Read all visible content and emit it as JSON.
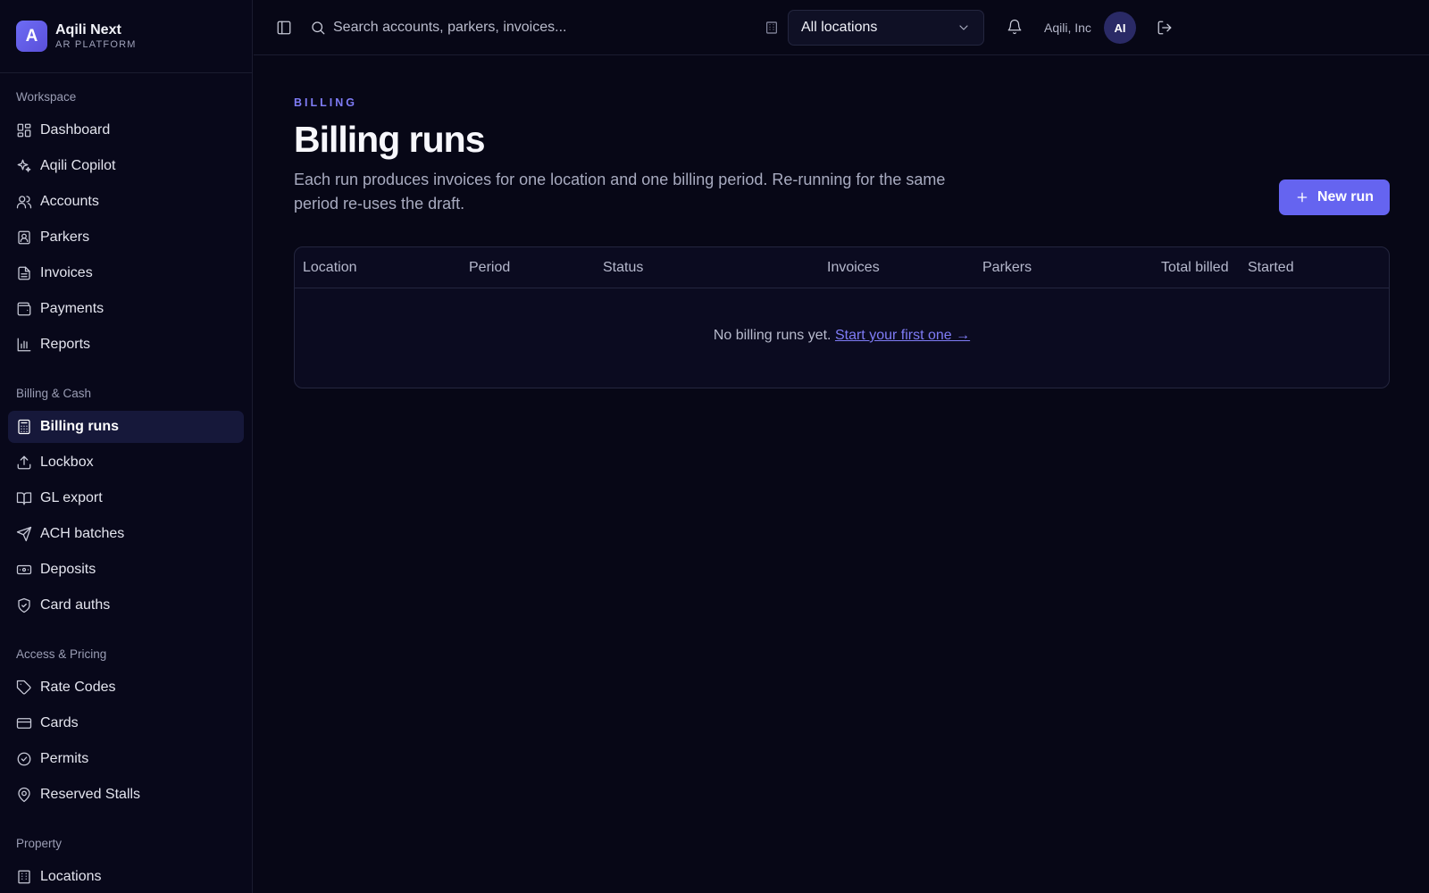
{
  "brand": {
    "logo_letter": "A",
    "name": "Aqili Next",
    "subtitle": "AR PLATFORM"
  },
  "sidebar": {
    "sections": [
      {
        "heading": "Workspace",
        "items": [
          {
            "label": "Dashboard",
            "icon": "dashboard-icon"
          },
          {
            "label": "Aqili Copilot",
            "icon": "sparkles-icon"
          },
          {
            "label": "Accounts",
            "icon": "users-icon"
          },
          {
            "label": "Parkers",
            "icon": "contact-icon"
          },
          {
            "label": "Invoices",
            "icon": "file-text-icon"
          },
          {
            "label": "Payments",
            "icon": "wallet-icon"
          },
          {
            "label": "Reports",
            "icon": "bar-chart-icon"
          }
        ]
      },
      {
        "heading": "Billing & Cash",
        "items": [
          {
            "label": "Billing runs",
            "icon": "calculator-icon",
            "active": true
          },
          {
            "label": "Lockbox",
            "icon": "upload-icon"
          },
          {
            "label": "GL export",
            "icon": "book-icon"
          },
          {
            "label": "ACH batches",
            "icon": "send-icon"
          },
          {
            "label": "Deposits",
            "icon": "banknote-icon"
          },
          {
            "label": "Card auths",
            "icon": "shield-check-icon"
          }
        ]
      },
      {
        "heading": "Access & Pricing",
        "items": [
          {
            "label": "Rate Codes",
            "icon": "tag-icon"
          },
          {
            "label": "Cards",
            "icon": "credit-card-icon"
          },
          {
            "label": "Permits",
            "icon": "badge-check-icon"
          },
          {
            "label": "Reserved Stalls",
            "icon": "map-pin-icon"
          }
        ]
      },
      {
        "heading": "Property",
        "items": [
          {
            "label": "Locations",
            "icon": "building-icon"
          }
        ]
      }
    ]
  },
  "topbar": {
    "search_placeholder": "Search accounts, parkers, invoices...",
    "location_selected": "All locations",
    "org_name": "Aqili, Inc",
    "avatar_initials": "AI"
  },
  "page": {
    "eyebrow": "BILLING",
    "title": "Billing runs",
    "description": "Each run produces invoices for one location and one billing period. Re-running for the same period re-uses the draft.",
    "new_run_label": "New run"
  },
  "table": {
    "columns": [
      "Location",
      "Period",
      "Status",
      "Invoices",
      "Parkers",
      "Total billed",
      "Started"
    ],
    "empty_text": "No billing runs yet.",
    "empty_link": "Start your first one →"
  },
  "colors": {
    "accent": "#6564f0",
    "background": "#070716",
    "sidebar": "#08081a",
    "active_item": "#16183a"
  }
}
